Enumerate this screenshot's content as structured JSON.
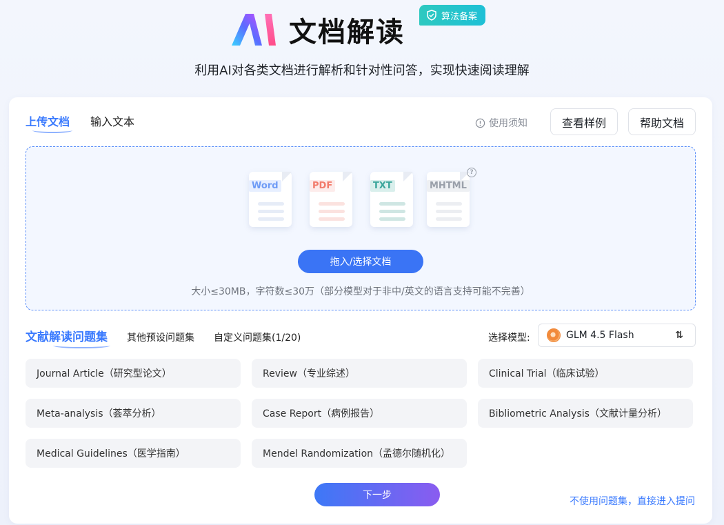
{
  "header": {
    "title": "文档解读",
    "badge": "算法备案",
    "subtitle": "利用AI对各类文档进行解析和针对性问答，实现快速阅读理解"
  },
  "upload_tabs": [
    {
      "label": "上传文档",
      "active": true
    },
    {
      "label": "输入文本",
      "active": false
    }
  ],
  "toolbar": {
    "notice": "使用须知",
    "sample_button": "查看样例",
    "help_button": "帮助文档"
  },
  "upload": {
    "file_types": [
      {
        "label": "Word",
        "color": "#5b8ff9"
      },
      {
        "label": "PDF",
        "color": "#f27b6b"
      },
      {
        "label": "TXT",
        "color": "#3aa59b"
      },
      {
        "label": "MHTML",
        "color": "#8a8f99"
      }
    ],
    "button": "拖入/选择文档",
    "hint": "大小≤30MB，字符数≤30万（部分模型对于非中/英文的语言支持可能不完善）"
  },
  "question_tabs": [
    {
      "label": "文献解读问题集",
      "active": true
    },
    {
      "label": "其他预设问题集",
      "active": false
    },
    {
      "label": "自定义问题集(1/20)",
      "active": false
    }
  ],
  "model": {
    "label": "选择模型:",
    "selected": "GLM 4.5 Flash"
  },
  "question_sets": [
    "Journal Article（研究型论文）",
    "Review（专业综述）",
    "Clinical Trial（临床试验）",
    "Meta-analysis（荟萃分析）",
    "Case Report（病例报告）",
    "Bibliometric Analysis（文献计量分析）",
    "Medical Guidelines（医学指南）",
    "Mendel Randomization（孟德尔随机化）"
  ],
  "footer": {
    "next_button": "下一步",
    "skip_link": "不使用问题集，直接进入提问"
  },
  "colors": {
    "accent": "#3a7afe",
    "badge": "#2ec9c0"
  }
}
